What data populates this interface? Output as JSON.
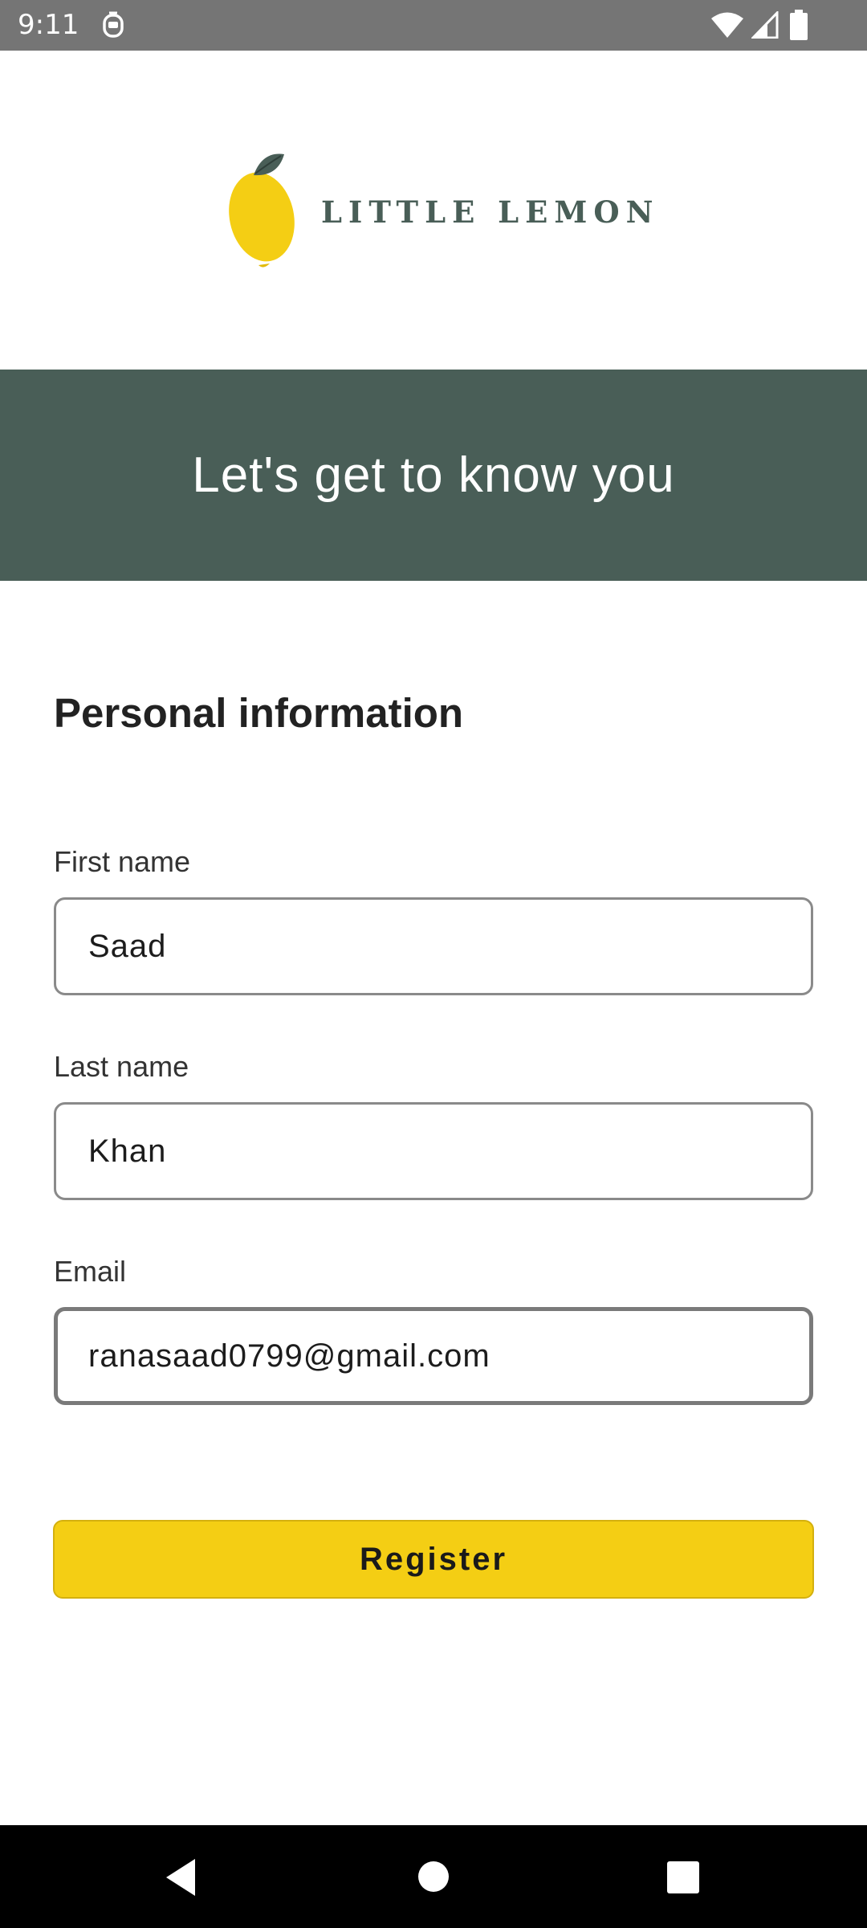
{
  "status_bar": {
    "time": "9:11",
    "icons": [
      "notification-icon",
      "wifi-icon",
      "signal-icon",
      "battery-icon"
    ]
  },
  "logo": {
    "text": "LITTLE LEMON",
    "icon": "lemon-icon"
  },
  "hero": {
    "title": "Let's get to know you"
  },
  "form": {
    "section_title": "Personal information",
    "first_name": {
      "label": "First name",
      "value": "Saad"
    },
    "last_name": {
      "label": "Last name",
      "value": "Khan"
    },
    "email": {
      "label": "Email",
      "value": "ranasaad0799@gmail.com"
    },
    "register_label": "Register"
  },
  "navigation": {
    "icons": [
      "back-icon",
      "home-icon",
      "recents-icon"
    ]
  },
  "colors": {
    "primary_green": "#495E57",
    "primary_yellow": "#F4CE14",
    "status_bar": "#757575",
    "nav_bar": "#000000"
  }
}
